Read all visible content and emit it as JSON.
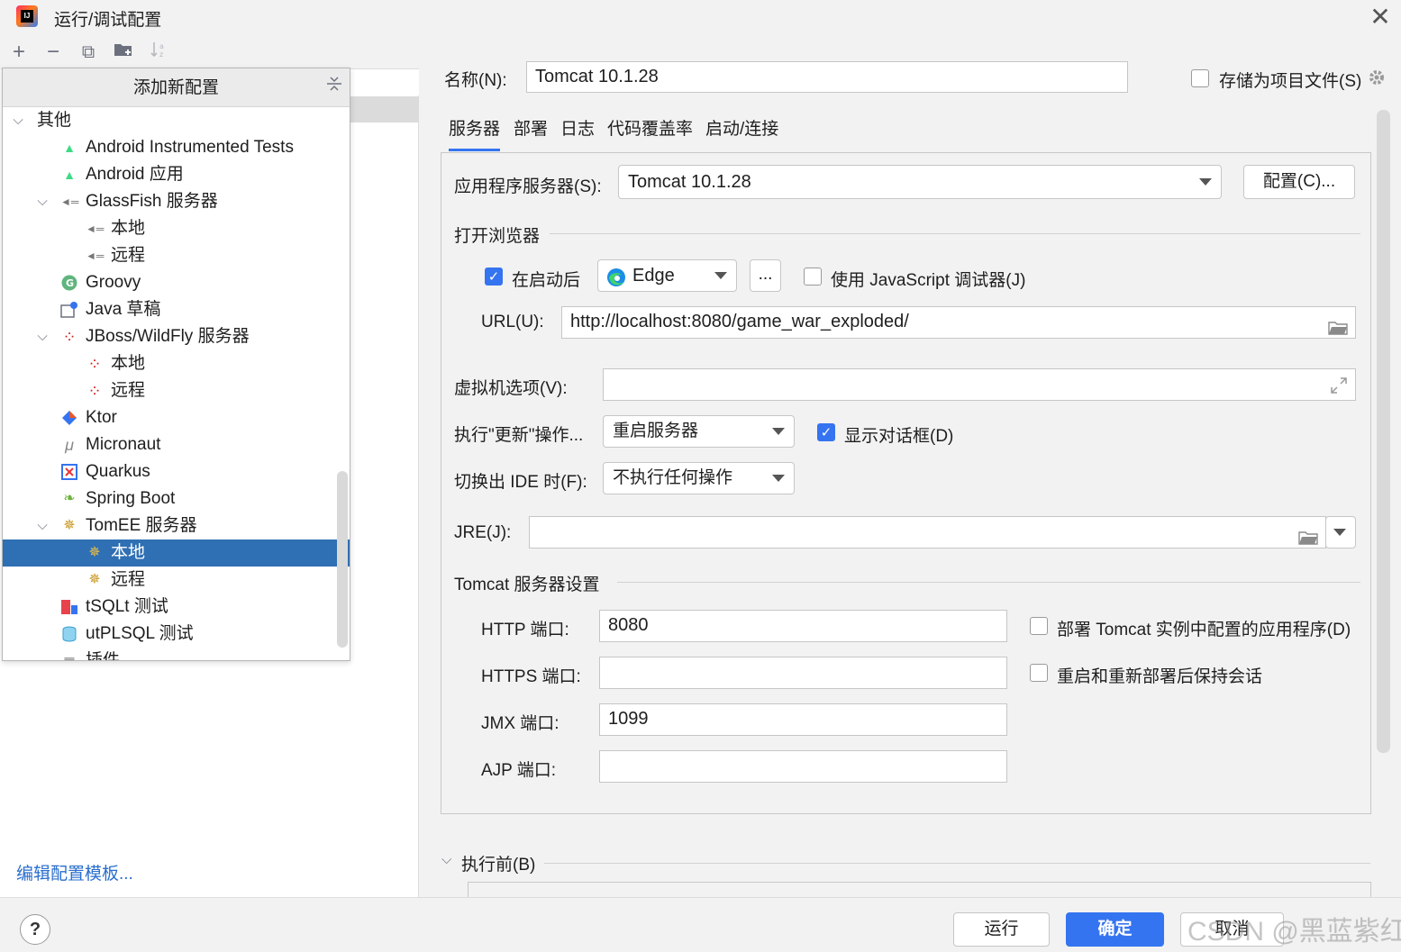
{
  "window": {
    "title": "运行/调试配置",
    "close_symbol": "✕"
  },
  "left_toolbar": {
    "add": "+",
    "remove": "−",
    "copy": "⧉",
    "folder": "▸",
    "sort": "↓"
  },
  "popup": {
    "title": "添加新配置",
    "items": [
      {
        "label": "其他",
        "expanded": true
      },
      {
        "label": "Android Instrumented Tests"
      },
      {
        "label": "Android 应用"
      },
      {
        "label": "GlassFish 服务器",
        "expanded": true
      },
      {
        "label": "本地"
      },
      {
        "label": "远程"
      },
      {
        "label": "Groovy"
      },
      {
        "label": "Java 草稿"
      },
      {
        "label": "JBoss/WildFly 服务器",
        "expanded": true
      },
      {
        "label": "本地"
      },
      {
        "label": "远程"
      },
      {
        "label": "Ktor"
      },
      {
        "label": "Micronaut"
      },
      {
        "label": "Quarkus"
      },
      {
        "label": "Spring Boot"
      },
      {
        "label": "TomEE 服务器",
        "expanded": true
      },
      {
        "label": "本地",
        "selected": true
      },
      {
        "label": "远程"
      },
      {
        "label": "tSQLt 测试"
      },
      {
        "label": "utPLSQL 测试"
      },
      {
        "label": "插件"
      }
    ]
  },
  "edit_templates_link": "编辑配置模板...",
  "config": {
    "name_label": "名称(N):",
    "name_value": "Tomcat 10.1.28",
    "store_as_project_file": "存储为项目文件(S)",
    "tabs": [
      "服务器",
      "部署",
      "日志",
      "代码覆盖率",
      "启动/连接"
    ],
    "active_tab": "服务器"
  },
  "server_tab": {
    "app_server_label": "应用程序服务器(S):",
    "app_server_value": "Tomcat 10.1.28",
    "configure_button": "配置(C)...",
    "open_browser_section": "打开浏览器",
    "after_launch_label": "在启动后",
    "after_launch_checked": true,
    "browser_value": "Edge",
    "browser_more_button": "...",
    "js_debugger_label": "使用 JavaScript 调试器(J)",
    "js_debugger_checked": false,
    "url_label": "URL(U):",
    "url_value": "http://localhost:8080/game_war_exploded/",
    "vm_options_label": "虚拟机选项(V):",
    "vm_options_value": "",
    "on_update_label": "执行\"更新\"操作...",
    "on_update_value": "重启服务器",
    "show_dialog_label": "显示对话框(D)",
    "show_dialog_checked": true,
    "on_frame_deactivation_label": "切换出 IDE 时(F):",
    "on_frame_deactivation_value": "不执行任何操作",
    "jre_label": "JRE(J):",
    "jre_value": "",
    "tomcat_section": "Tomcat 服务器设置",
    "http_port_label": "HTTP 端口:",
    "http_port_value": "8080",
    "https_port_label": "HTTPS 端口:",
    "https_port_value": "",
    "jmx_port_label": "JMX 端口:",
    "jmx_port_value": "1099",
    "ajp_port_label": "AJP 端口:",
    "ajp_port_value": "",
    "deploy_configured_label": "部署 Tomcat 实例中配置的应用程序(D)",
    "deploy_configured_checked": false,
    "preserve_sessions_label": "重启和重新部署后保持会话",
    "preserve_sessions_checked": false
  },
  "before_launch_label": "执行前(B)",
  "footer": {
    "help": "?",
    "run_button": "运行",
    "ok_button": "确定",
    "cancel_button": "取消",
    "watermark": "CSDN @黑蓝紫红"
  },
  "colors": {
    "accent": "#3574f0",
    "selection": "#2f6fb3",
    "link": "#2a6ecd"
  }
}
